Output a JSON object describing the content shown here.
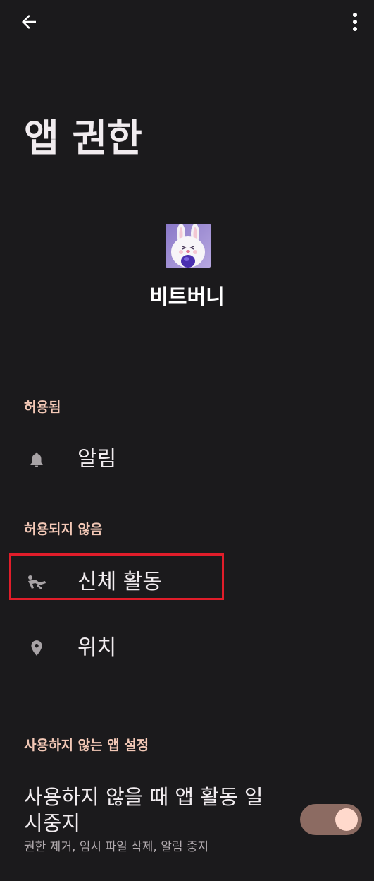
{
  "header": {
    "back_icon": "arrow-left-icon",
    "more_icon": "more-vertical-icon",
    "title": "앱 권한"
  },
  "app": {
    "icon": "bunny-app-icon",
    "name": "비트버니"
  },
  "sections": {
    "allowed": {
      "header": "허용됨",
      "items": [
        {
          "label": "알림",
          "icon": "bell-icon"
        }
      ]
    },
    "not_allowed": {
      "header": "허용되지 않음",
      "items": [
        {
          "label": "신체 활동",
          "icon": "physical-activity-icon"
        },
        {
          "label": "위치",
          "icon": "location-pin-icon"
        }
      ]
    },
    "unused": {
      "header": "사용하지 않는 앱 설정",
      "setting": {
        "title": "사용하지 않을 때 앱 활동 일시중지",
        "subtitle": "권한 제거, 임시 파일 삭제, 알림 중지",
        "enabled": true
      }
    }
  },
  "colors": {
    "background": "#1b1a1c",
    "section_header": "#f3c8b6",
    "highlight": "#e11d2a",
    "toggle_track": "#8c6b62",
    "toggle_knob": "#ffd9cc"
  }
}
